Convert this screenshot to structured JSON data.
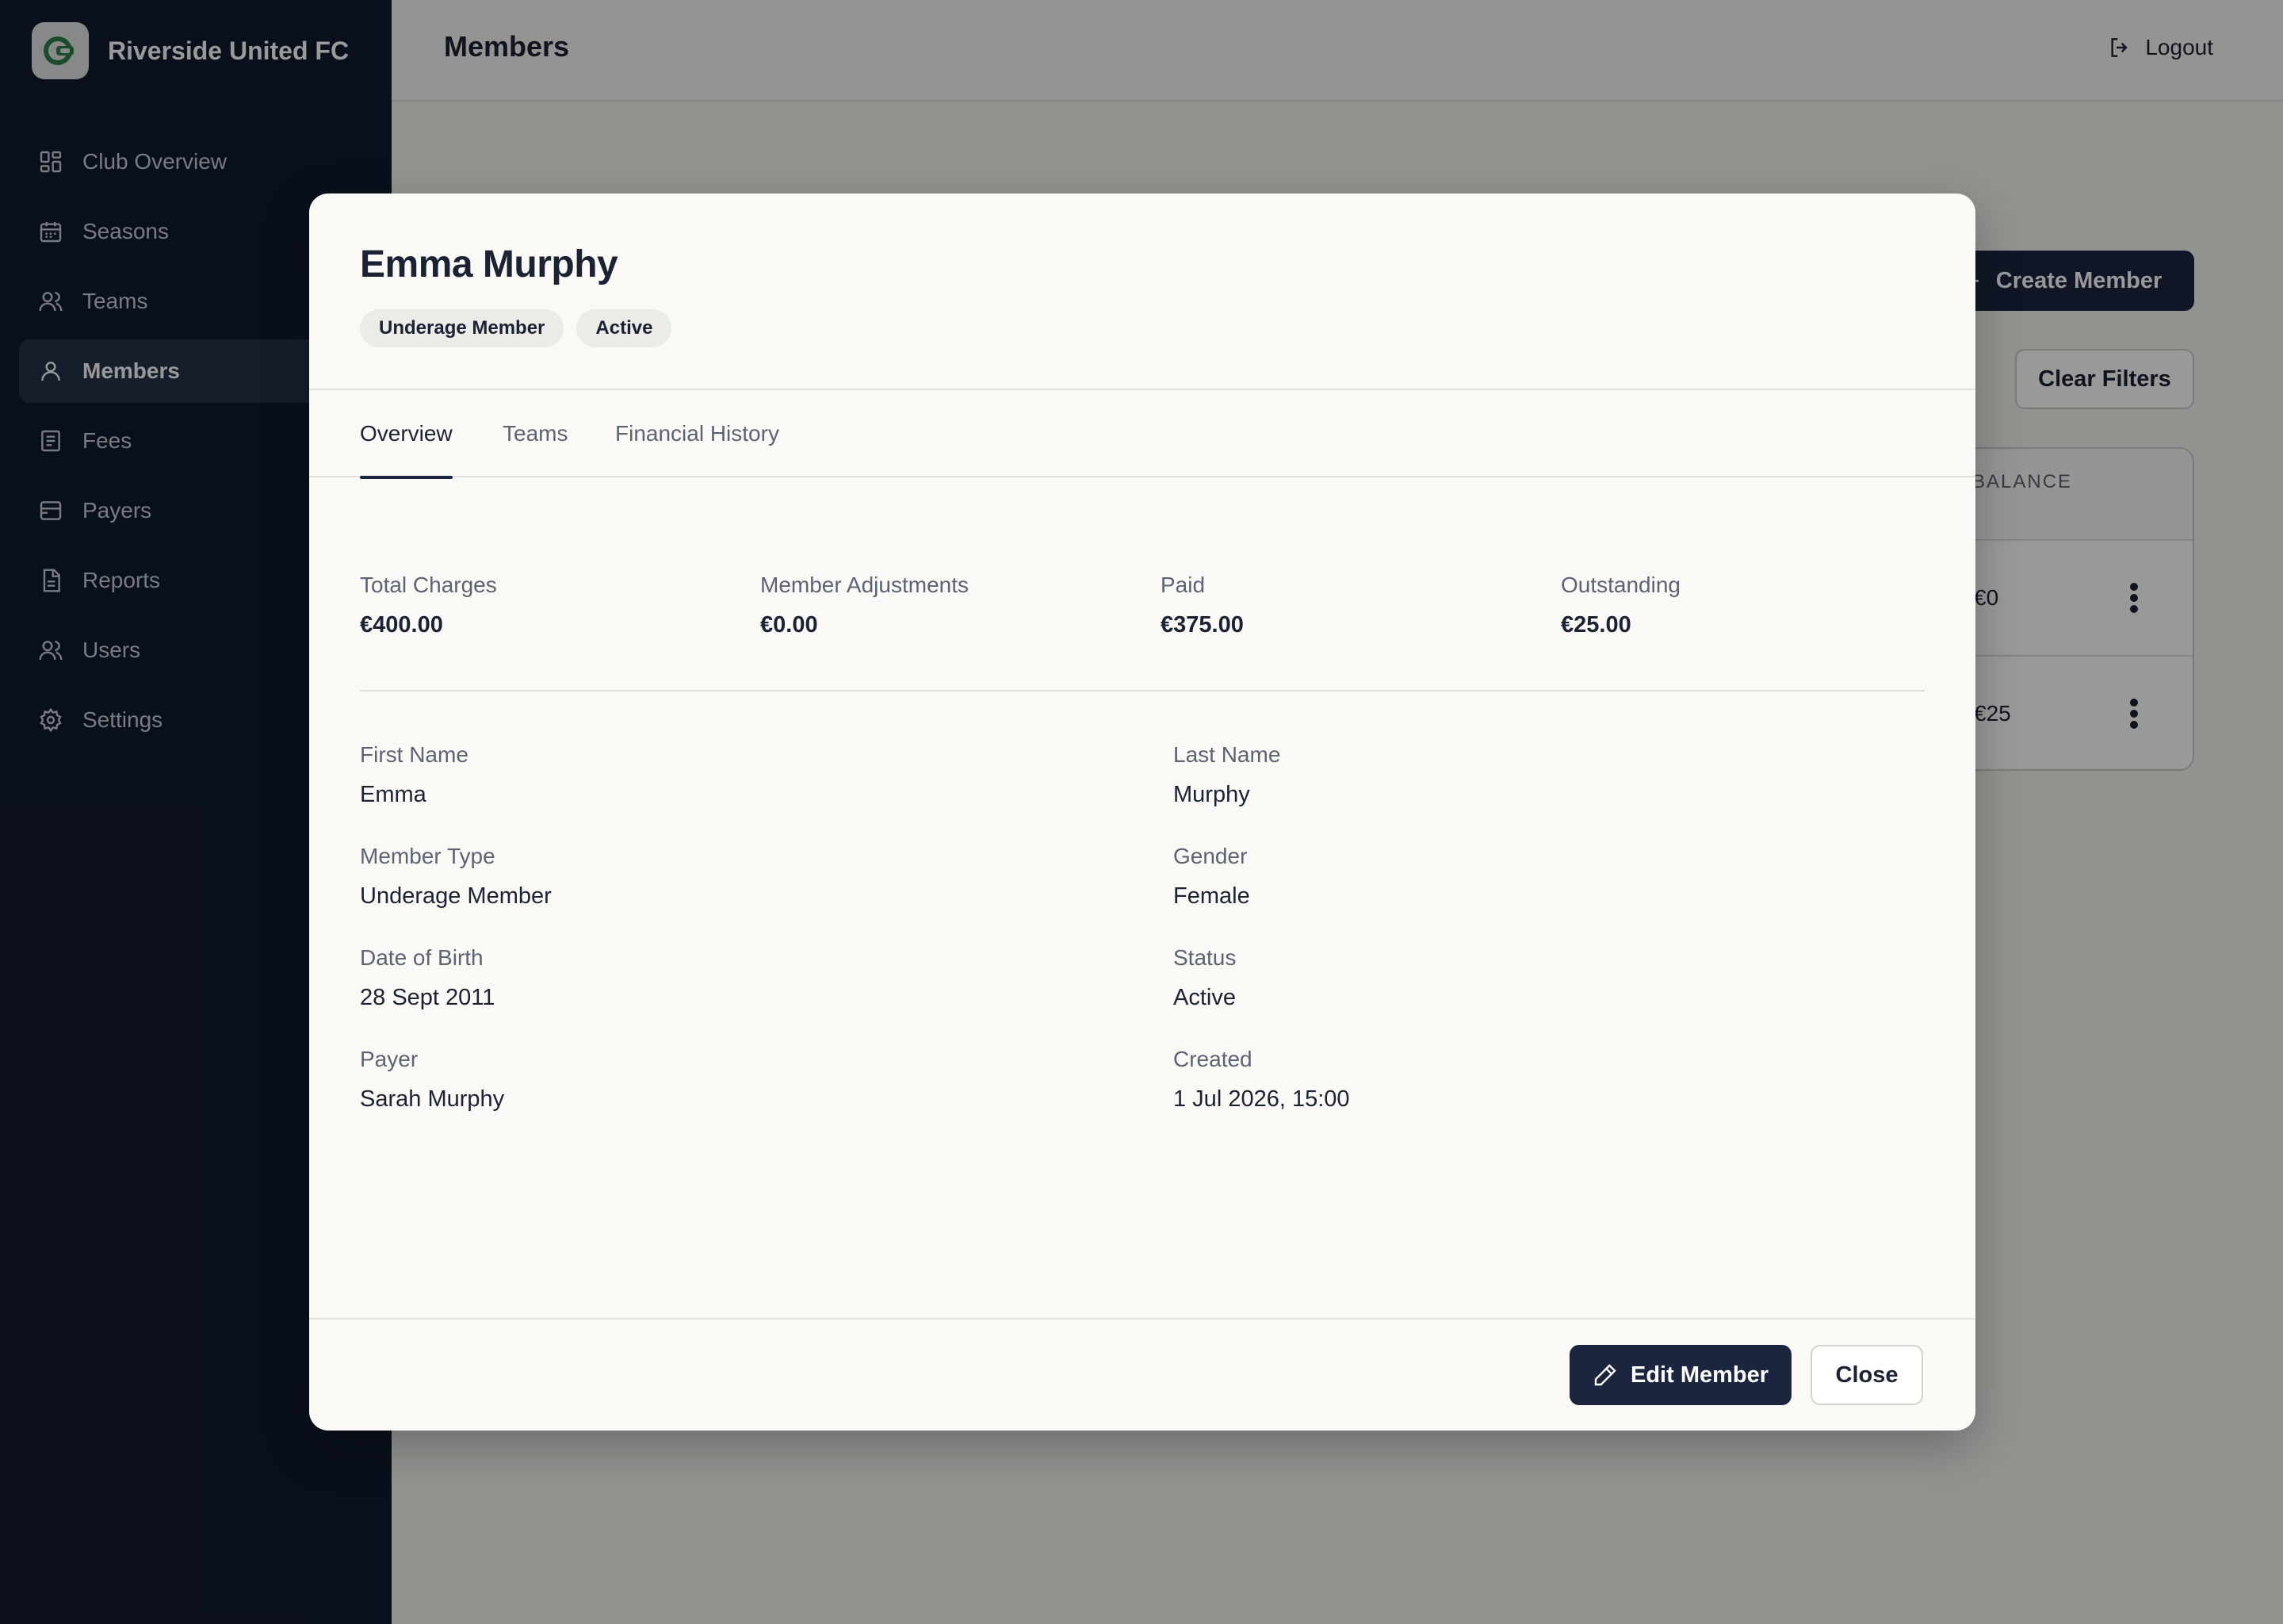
{
  "app": {
    "club_name": "Riverside United FC"
  },
  "sidebar": {
    "items": [
      {
        "label": "Club Overview",
        "icon": "grid-icon"
      },
      {
        "label": "Seasons",
        "icon": "calendar-icon"
      },
      {
        "label": "Teams",
        "icon": "users-icon"
      },
      {
        "label": "Members",
        "icon": "user-icon",
        "active": true
      },
      {
        "label": "Fees",
        "icon": "receipt-icon"
      },
      {
        "label": "Payers",
        "icon": "wallet-icon"
      },
      {
        "label": "Reports",
        "icon": "file-icon"
      },
      {
        "label": "Users",
        "icon": "users-icon"
      },
      {
        "label": "Settings",
        "icon": "gear-icon"
      }
    ]
  },
  "header": {
    "title": "Members",
    "logout_label": "Logout"
  },
  "background": {
    "create_label": "Create Member",
    "clear_filters_label": "Clear Filters",
    "table": {
      "column": "BALANCE",
      "rows": [
        "€0",
        "€25"
      ]
    }
  },
  "modal": {
    "title": "Emma Murphy",
    "badges": [
      "Underage Member",
      "Active"
    ],
    "tabs": [
      "Overview",
      "Teams",
      "Financial History"
    ],
    "active_tab": "Overview",
    "stats": [
      {
        "label": "Total Charges",
        "value": "€400.00"
      },
      {
        "label": "Member Adjustments",
        "value": "€0.00"
      },
      {
        "label": "Paid",
        "value": "€375.00"
      },
      {
        "label": "Outstanding",
        "value": "€25.00"
      }
    ],
    "fields": [
      {
        "label": "First Name",
        "value": "Emma"
      },
      {
        "label": "Last Name",
        "value": "Murphy"
      },
      {
        "label": "Member Type",
        "value": "Underage Member"
      },
      {
        "label": "Gender",
        "value": "Female"
      },
      {
        "label": "Date of Birth",
        "value": "28 Sept 2011"
      },
      {
        "label": "Status",
        "value": "Active"
      },
      {
        "label": "Payer",
        "value": "Sarah Murphy"
      },
      {
        "label": "Created",
        "value": "1 Jul 2026, 15:00"
      }
    ],
    "edit_label": "Edit Member",
    "close_label": "Close"
  },
  "colors": {
    "sidebar": "#121b2e",
    "primary": "#1b2540",
    "accent": "#2f7d4a"
  }
}
